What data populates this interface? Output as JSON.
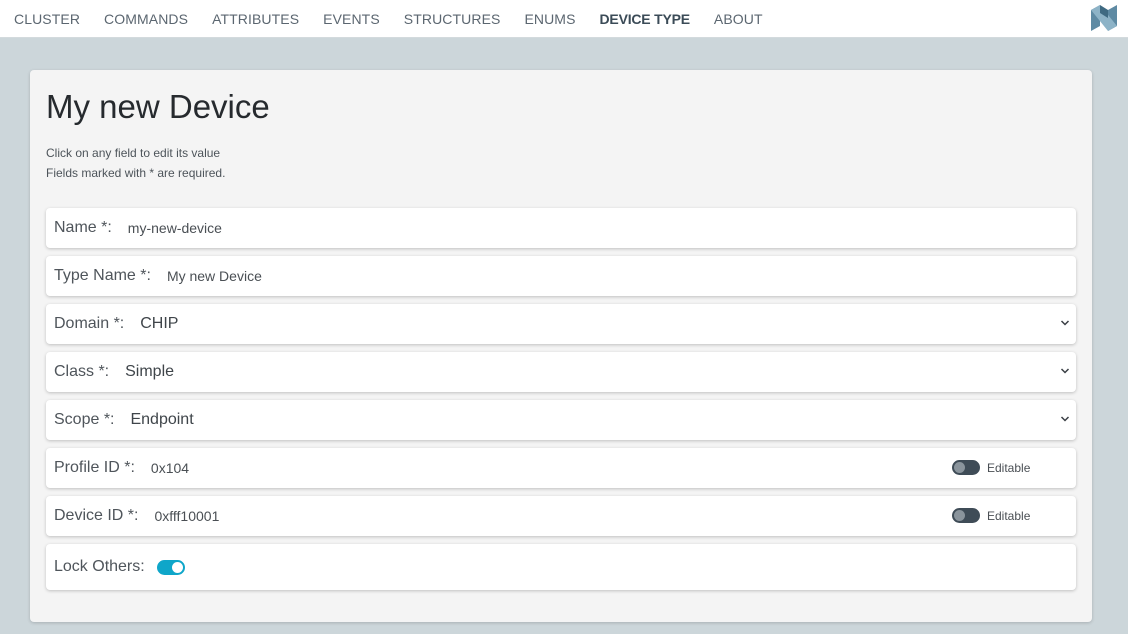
{
  "nav": {
    "items": [
      {
        "label": "CLUSTER"
      },
      {
        "label": "COMMANDS"
      },
      {
        "label": "ATTRIBUTES"
      },
      {
        "label": "EVENTS"
      },
      {
        "label": "STRUCTURES"
      },
      {
        "label": "ENUMS"
      },
      {
        "label": "DEVICE TYPE",
        "active": true
      },
      {
        "label": "ABOUT"
      }
    ]
  },
  "page": {
    "title": "My new Device",
    "hint_line1": "Click on any field to edit its value",
    "hint_line2": "Fields marked with * are required."
  },
  "fields": {
    "name": {
      "label": "Name *:",
      "value": "my-new-device"
    },
    "type_name": {
      "label": "Type Name *:",
      "value": "My new Device"
    },
    "domain": {
      "label": "Domain *:",
      "value": "CHIP"
    },
    "class": {
      "label": "Class *:",
      "value": "Simple"
    },
    "scope": {
      "label": "Scope *:",
      "value": "Endpoint"
    },
    "profile_id": {
      "label": "Profile ID *:",
      "value": "0x104",
      "toggle_label": "Editable",
      "editable": false
    },
    "device_id": {
      "label": "Device ID *:",
      "value": "0xfff10001",
      "toggle_label": "Editable",
      "editable": false
    },
    "lock_others": {
      "label": "Lock Others:",
      "enabled": true
    }
  },
  "colors": {
    "background": "#ccd6da",
    "accent": "#0fa6c9",
    "toggle_off": "#3f4c57"
  }
}
